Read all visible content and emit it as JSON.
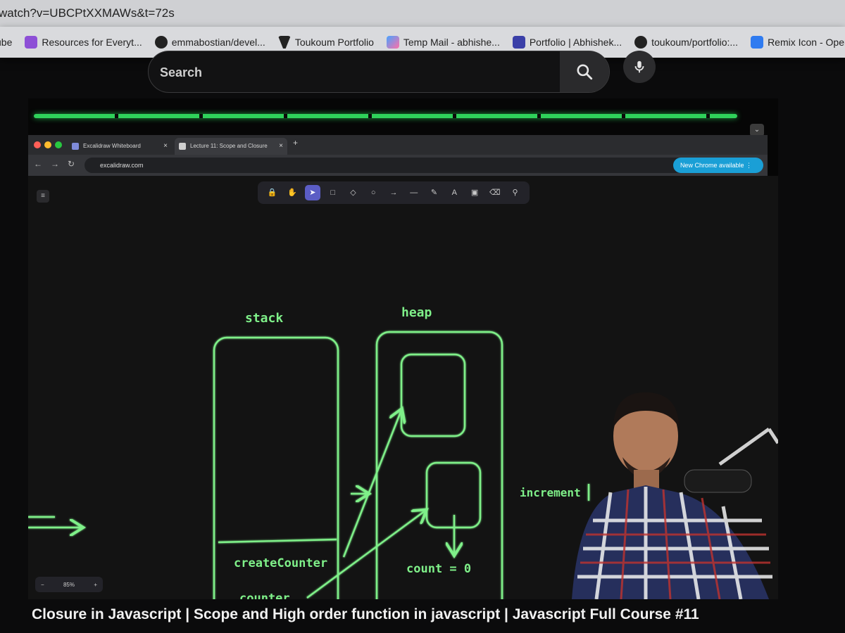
{
  "browser": {
    "url_fragment": "watch?v=UBCPtXXMAWs&t=72s",
    "bookmarks": [
      {
        "label": "ube",
        "color": ""
      },
      {
        "label": "Resources for Everyt...",
        "color": "#8d4fd6"
      },
      {
        "label": "emmabostian/devel...",
        "color": "#222222"
      },
      {
        "label": "Toukoum Portfolio",
        "color": "#222222"
      },
      {
        "label": "Temp Mail - abhishe...",
        "color": "#47a3ff"
      },
      {
        "label": "Portfolio | Abhishek...",
        "color": "#3a3fa8"
      },
      {
        "label": "toukoum/portfolio:...",
        "color": "#222222"
      },
      {
        "label": "Remix Icon - Open s...",
        "color": "#2f7bf0"
      }
    ]
  },
  "youtube": {
    "search_placeholder": "Search",
    "video_title": "Closure in Javascript | Scope and High order function in javascript | Javascript Full Course #11",
    "progress_fraction": 0.97
  },
  "inner_browser": {
    "tabs": [
      {
        "label": "Excalidraw Whiteboard"
      },
      {
        "label": "Lecture 11: Scope and Closure"
      }
    ],
    "url": "excalidraw.com",
    "update_pill": "New Chrome available"
  },
  "excalidraw": {
    "zoom_minus": "−",
    "zoom_level": "85%",
    "zoom_plus": "+",
    "labels": {
      "stack": "stack",
      "heap": "heap",
      "create_counter": "createCounter",
      "counter": "counter",
      "count": "count = 0",
      "increment": "increment"
    },
    "stroke_color": "#7ff089"
  },
  "icons": {
    "search": "search-icon",
    "mic": "mic-icon"
  }
}
